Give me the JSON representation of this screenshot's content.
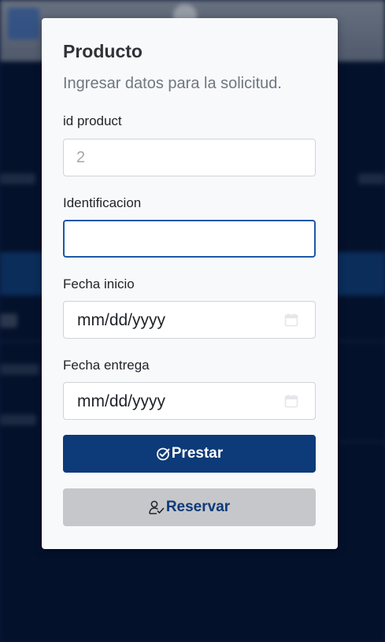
{
  "modal": {
    "title": "Producto",
    "subtitle": "Ingresar datos para la solicitud."
  },
  "fields": {
    "id_product": {
      "label": "id product",
      "placeholder": "2",
      "value": ""
    },
    "identificacion": {
      "label": "Identificacion",
      "value": ""
    },
    "fecha_inicio": {
      "label": "Fecha inicio",
      "display": "mm/dd/yyyy",
      "icon": "calendar-icon"
    },
    "fecha_entrega": {
      "label": "Fecha entrega",
      "display": "mm/dd/yyyy",
      "icon": "calendar-icon"
    }
  },
  "buttons": {
    "prestar": {
      "label": "Prestar",
      "icon": "check-badge-icon"
    },
    "reservar": {
      "label": "Reservar",
      "icon": "user-check-icon"
    }
  },
  "colors": {
    "primary": "#0d3a78",
    "secondary": "#c6c7ca",
    "focus_border": "#1c57a8",
    "backdrop": "#06173a"
  }
}
